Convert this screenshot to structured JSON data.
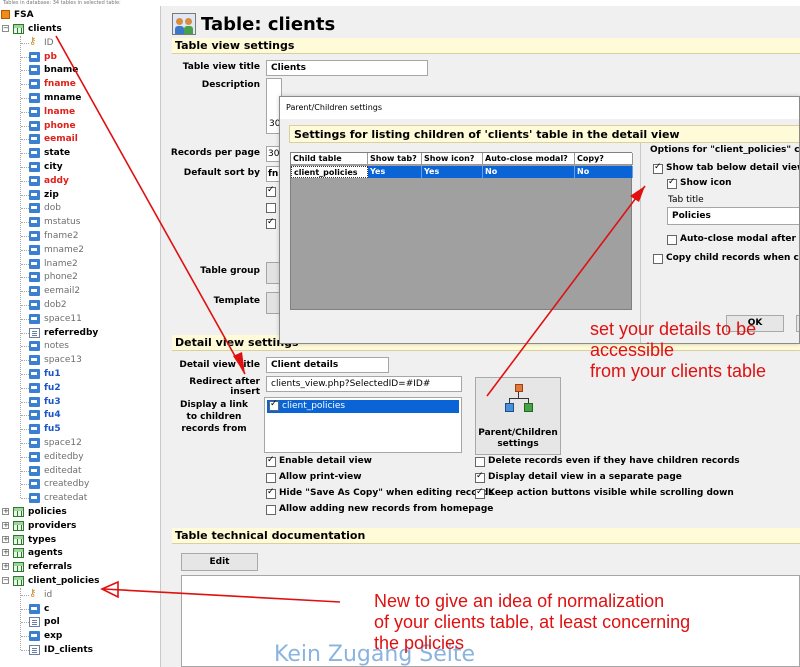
{
  "status_text": "Tables in database: 34 tables in selected table:",
  "tree": {
    "root_label": "FSA",
    "tables": [
      {
        "label": "clients",
        "expanded": true
      },
      {
        "label": "policies",
        "expanded": false
      },
      {
        "label": "providers",
        "expanded": false
      },
      {
        "label": "types",
        "expanded": false
      },
      {
        "label": "agents",
        "expanded": false
      },
      {
        "label": "referrals",
        "expanded": false
      },
      {
        "label": "client_policies",
        "expanded": true
      }
    ],
    "client_fields": [
      {
        "label": "ID",
        "color": "gray",
        "icon": "key-icon"
      },
      {
        "label": "pb",
        "color": "red",
        "icon": "field-icon"
      },
      {
        "label": "bname",
        "color": "black",
        "icon": "field-icon"
      },
      {
        "label": "fname",
        "color": "red",
        "icon": "field-icon"
      },
      {
        "label": "mname",
        "color": "black",
        "icon": "field-icon"
      },
      {
        "label": "lname",
        "color": "red",
        "icon": "field-icon"
      },
      {
        "label": "phone",
        "color": "red",
        "icon": "field-icon"
      },
      {
        "label": "eemail",
        "color": "red",
        "icon": "field-icon"
      },
      {
        "label": "state",
        "color": "black",
        "icon": "field-icon"
      },
      {
        "label": "city",
        "color": "black",
        "icon": "field-icon"
      },
      {
        "label": "addy",
        "color": "red",
        "icon": "field-icon"
      },
      {
        "label": "zip",
        "color": "black",
        "icon": "field-icon"
      },
      {
        "label": "dob",
        "color": "gray",
        "icon": "field-icon"
      },
      {
        "label": "mstatus",
        "color": "gray",
        "icon": "field-icon"
      },
      {
        "label": "fname2",
        "color": "gray",
        "icon": "field-icon"
      },
      {
        "label": "mname2",
        "color": "gray",
        "icon": "field-icon"
      },
      {
        "label": "lname2",
        "color": "gray",
        "icon": "field-icon"
      },
      {
        "label": "phone2",
        "color": "gray",
        "icon": "field-icon"
      },
      {
        "label": "eemail2",
        "color": "gray",
        "icon": "field-icon"
      },
      {
        "label": "dob2",
        "color": "gray",
        "icon": "field-icon"
      },
      {
        "label": "space11",
        "color": "gray",
        "icon": "field-icon"
      },
      {
        "label": "referredby",
        "color": "black",
        "icon": "doc-icon"
      },
      {
        "label": "notes",
        "color": "gray",
        "icon": "field-icon"
      },
      {
        "label": "space13",
        "color": "gray",
        "icon": "field-icon"
      },
      {
        "label": "fu1",
        "color": "blue",
        "icon": "field-icon"
      },
      {
        "label": "fu2",
        "color": "blue",
        "icon": "field-icon"
      },
      {
        "label": "fu3",
        "color": "blue",
        "icon": "field-icon"
      },
      {
        "label": "fu4",
        "color": "blue",
        "icon": "field-icon"
      },
      {
        "label": "fu5",
        "color": "blue",
        "icon": "field-icon"
      },
      {
        "label": "space12",
        "color": "gray",
        "icon": "field-icon"
      },
      {
        "label": "editedby",
        "color": "gray",
        "icon": "field-icon"
      },
      {
        "label": "editedat",
        "color": "gray",
        "icon": "field-icon"
      },
      {
        "label": "createdby",
        "color": "gray",
        "icon": "field-icon"
      },
      {
        "label": "createdat",
        "color": "gray",
        "icon": "field-icon"
      }
    ],
    "client_policies_fields": [
      {
        "label": "id",
        "color": "gray",
        "icon": "key-icon"
      },
      {
        "label": "c",
        "color": "black",
        "icon": "field-icon"
      },
      {
        "label": "pol",
        "color": "black",
        "icon": "doc-icon"
      },
      {
        "label": "exp",
        "color": "black",
        "icon": "field-icon"
      },
      {
        "label": "ID_clients",
        "color": "black",
        "icon": "doc-icon"
      }
    ]
  },
  "main": {
    "page_title": "Table: clients",
    "table_view": {
      "section_title": "Table view settings",
      "title_label": "Table view title",
      "title_value": "Clients",
      "description_label": "Description",
      "description_partial": "30",
      "records_per_page_label": "Records per page",
      "records_per_page_value": "30",
      "default_sort_label": "Default sort by",
      "default_sort_value": "fn",
      "table_group_label": "Table group",
      "template_label": "Template"
    },
    "detail_view": {
      "section_title": "Detail view settings",
      "title_label": "Detail view title",
      "title_value": "Client details",
      "redirect_label": "Redirect after insert",
      "redirect_value": "clients_view.php?SelectedID=#ID#",
      "display_link_label_1": "Display a link",
      "display_link_label_2": "to children",
      "display_link_label_3": "records from",
      "children_list": [
        "client_policies"
      ],
      "parent_children_button_1": "Parent/Children",
      "parent_children_button_2": "settings",
      "left_checks": [
        {
          "label": "Enable detail view",
          "checked": true
        },
        {
          "label": "Allow print-view",
          "checked": false
        },
        {
          "label": "Hide \"Save As Copy\" when editing records",
          "checked": true
        },
        {
          "label": "Allow adding new records from homepage",
          "checked": false
        }
      ],
      "right_checks": [
        {
          "label": "Delete records even if they have children records",
          "checked": false
        },
        {
          "label": "Display detail view in a separate page",
          "checked": true
        },
        {
          "label": "Keep action buttons visible while scrolling down",
          "checked": true
        }
      ]
    },
    "tech_doc": {
      "section_title": "Table technical documentation",
      "edit_button": "Edit",
      "watermark": "Kein Zugang Seite"
    }
  },
  "dialog": {
    "window_title": "Parent/Children settings",
    "heading": "Settings for listing children of 'clients' table in the detail view",
    "columns": [
      "Child table",
      "Show tab?",
      "Show icon?",
      "Auto-close modal?",
      "Copy?"
    ],
    "rows": [
      [
        "client_policies",
        "Yes",
        "Yes",
        "No",
        "No"
      ]
    ],
    "options_title": "Options for \"client_policies\" child t",
    "show_tab_label": "Show tab below detail view",
    "show_icon_label": "Show icon",
    "tab_title_label": "Tab title",
    "tab_title_value": "Policies",
    "auto_close_label": "Auto-close modal after saving",
    "copy_child_label": "Copy child records when copyin",
    "ok_button": "OK"
  },
  "annotations": {
    "top_line_1": "set your details to be",
    "top_line_2": "accessible",
    "top_line_3": "from your clients table",
    "bottom_line_1": "New to give an idea of normalization",
    "bottom_line_2": "of your clients table, at least concerning",
    "bottom_line_3": "the policies"
  },
  "colors": {
    "annotation_red": "#e01010",
    "field_red": "#e0201a",
    "field_blue": "#1a55c8",
    "section_yellow": "#fffbd8",
    "selection_blue": "#0a64d6"
  }
}
